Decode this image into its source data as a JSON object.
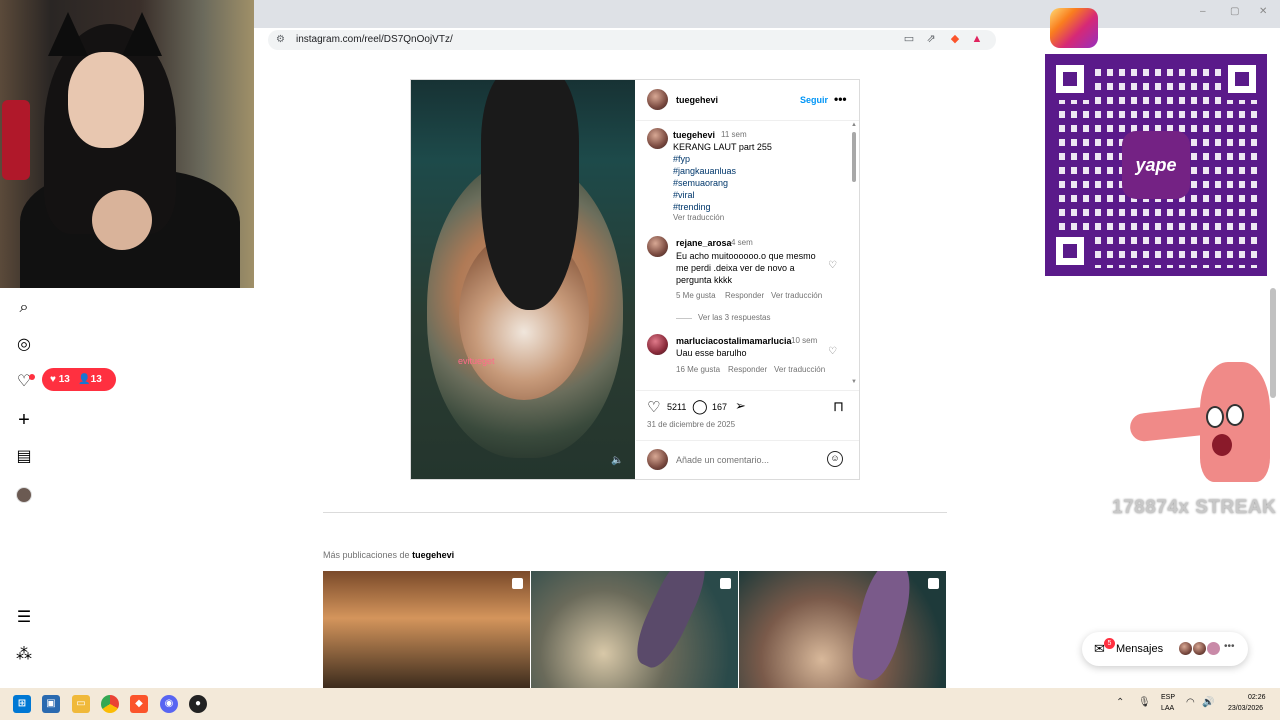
{
  "browser": {
    "url": "instagram.com/reel/DS7QnOojVTz/",
    "win_min": "–",
    "win_max": "▢",
    "win_close": "✕"
  },
  "nav": {
    "search": "⌕",
    "explore": "◎",
    "notifications": "♡",
    "create": "+",
    "dashboard": "▤",
    "menu": "☰",
    "threads": "⁂",
    "notif_likes": "13",
    "notif_followers": "13"
  },
  "post": {
    "username": "tuegehevi",
    "follow": "Seguir",
    "more": "•••",
    "watermark": "evitueget",
    "caption": {
      "username": "tuegehevi",
      "time": "11 sem",
      "text": "KERANG LAUT part 255",
      "tags": [
        "#fyp",
        "#jangkauanluas",
        "#semuaorang",
        "#viral",
        "#trending"
      ],
      "translate": "Ver traducción"
    },
    "comments": [
      {
        "username": "rejane_arosa",
        "time": "4 sem",
        "text": "Eu acho muitoooooo.o que mesmo me perdi .deixa ver de novo a pergunta kkkk",
        "likes": "5 Me gusta",
        "reply": "Responder",
        "translate": "Ver traducción",
        "view_replies": "Ver las 3 respuestas"
      },
      {
        "username": "marluciacostalimamarlucia",
        "time": "10 sem",
        "text": "Uau esse barulho",
        "likes": "16 Me gusta",
        "reply": "Responder",
        "translate": "Ver traducción"
      }
    ],
    "like_count": "5211",
    "comment_count": "167",
    "date": "31 de diciembre de 2025",
    "comment_placeholder": "Añade un comentario..."
  },
  "more_posts": {
    "label": "Más publicaciones de",
    "username": "tuegehevi"
  },
  "overlays": {
    "yape": "yape",
    "streak": "178874x STREAK"
  },
  "messages": {
    "label": "Mensajes",
    "count": "5",
    "more": "•••"
  },
  "taskbar": {
    "lang1": "ESP",
    "lang2": "LAA",
    "time": "02:26",
    "date": "23/03/2026"
  },
  "colors": {
    "accent": "#0095f6",
    "notification": "#ff3040",
    "qr": "#5a1a8a"
  }
}
